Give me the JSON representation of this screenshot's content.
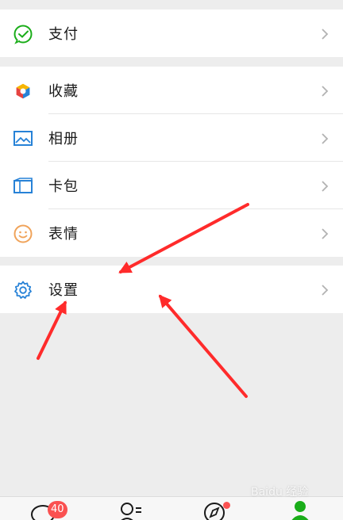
{
  "menu": {
    "pay": {
      "label": "支付",
      "icon": "wechat-pay-icon"
    },
    "favorites": {
      "label": "收藏",
      "icon": "cube-icon"
    },
    "album": {
      "label": "相册",
      "icon": "image-icon"
    },
    "cards": {
      "label": "卡包",
      "icon": "card-icon"
    },
    "stickers": {
      "label": "表情",
      "icon": "smiley-icon"
    },
    "settings": {
      "label": "设置",
      "icon": "gear-icon"
    }
  },
  "bottom_nav": {
    "chats_badge": "40",
    "items": [
      "chat-bubble-icon",
      "contacts-icon",
      "compass-icon",
      "me-icon"
    ]
  },
  "watermark": "Baidu 经验",
  "colors": {
    "green": "#1aad19",
    "arrow": "#ff2b2b",
    "badge": "#fa5151"
  }
}
